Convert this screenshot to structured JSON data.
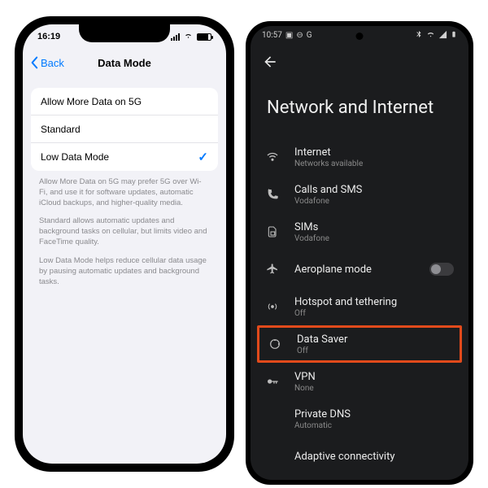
{
  "ios": {
    "status": {
      "time": "16:19"
    },
    "nav": {
      "back": "Back",
      "title": "Data Mode"
    },
    "options": [
      {
        "label": "Allow More Data on 5G",
        "selected": false
      },
      {
        "label": "Standard",
        "selected": false
      },
      {
        "label": "Low Data Mode",
        "selected": true
      }
    ],
    "footer": {
      "p1": "Allow More Data on 5G may prefer 5G over Wi-Fi, and use it for software updates, automatic iCloud backups, and higher-quality media.",
      "p2": "Standard allows automatic updates and background tasks on cellular, but limits video and FaceTime quality.",
      "p3": "Low Data Mode helps reduce cellular data usage by pausing automatic updates and background tasks."
    }
  },
  "android": {
    "status": {
      "time": "10:57",
      "extras": "G"
    },
    "title": "Network and Internet",
    "items": {
      "internet": {
        "label": "Internet",
        "sub": "Networks available"
      },
      "calls": {
        "label": "Calls and SMS",
        "sub": "Vodafone"
      },
      "sims": {
        "label": "SIMs",
        "sub": "Vodafone"
      },
      "aeroplane": {
        "label": "Aeroplane mode"
      },
      "hotspot": {
        "label": "Hotspot and tethering",
        "sub": "Off"
      },
      "datasaver": {
        "label": "Data Saver",
        "sub": "Off"
      },
      "vpn": {
        "label": "VPN",
        "sub": "None"
      },
      "dns": {
        "label": "Private DNS",
        "sub": "Automatic"
      },
      "adaptive": {
        "label": "Adaptive connectivity"
      }
    },
    "highlighted": "datasaver"
  }
}
